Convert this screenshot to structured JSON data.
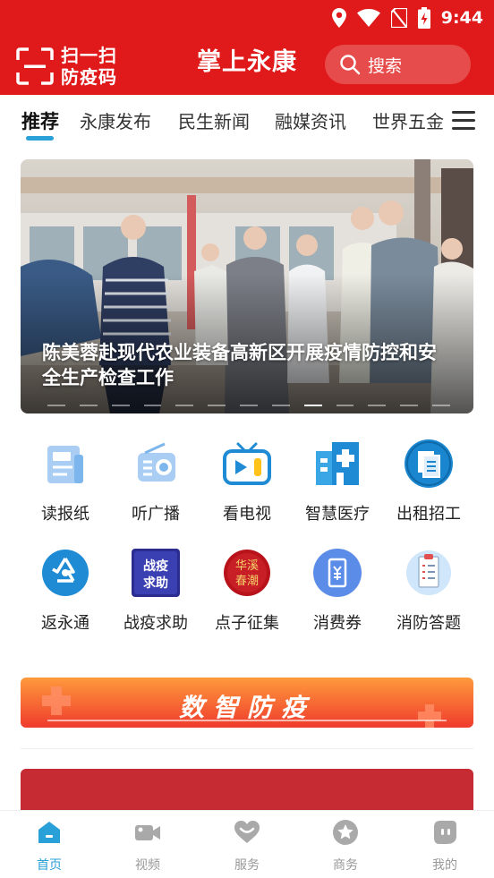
{
  "status": {
    "time": "9:44"
  },
  "header": {
    "scan_line1": "扫一扫",
    "scan_line2": "防疫码",
    "title": "掌上永康",
    "search_label": "搜索"
  },
  "tabs": [
    {
      "label": "推荐"
    },
    {
      "label": "永康发布"
    },
    {
      "label": "民生新闻"
    },
    {
      "label": "融媒资讯"
    },
    {
      "label": "世界五金"
    }
  ],
  "banner": {
    "caption": "陈美蓉赴现代农业装备高新区开展疫情防控和安全生产检查工作"
  },
  "services": [
    {
      "label": "读报纸",
      "icon": "newspaper-icon"
    },
    {
      "label": "听广播",
      "icon": "radio-icon"
    },
    {
      "label": "看电视",
      "icon": "tv-icon"
    },
    {
      "label": "智慧医疗",
      "icon": "hospital-icon"
    },
    {
      "label": "出租招工",
      "icon": "document-icon"
    },
    {
      "label": "返永通",
      "icon": "recycle-icon"
    },
    {
      "label": "战疫求助",
      "icon": "help-badge-icon"
    },
    {
      "label": "点子征集",
      "icon": "idea-seal-icon"
    },
    {
      "label": "消费券",
      "icon": "coupon-icon"
    },
    {
      "label": "消防答题",
      "icon": "clipboard-icon"
    }
  ],
  "service_badge_texts": {
    "help": "战疫求助",
    "idea_top": "华溪",
    "idea_bottom": "春潮"
  },
  "promo": {
    "label": "数智防疫"
  },
  "nav": [
    {
      "label": "首页",
      "icon": "home-icon"
    },
    {
      "label": "视频",
      "icon": "video-icon"
    },
    {
      "label": "服务",
      "icon": "heart-icon"
    },
    {
      "label": "商务",
      "icon": "star-icon"
    },
    {
      "label": "我的",
      "icon": "profile-icon"
    }
  ],
  "colors": {
    "brand_red": "#e01a1a",
    "accent_blue": "#2aa0d8",
    "nav_gray": "#999999"
  }
}
